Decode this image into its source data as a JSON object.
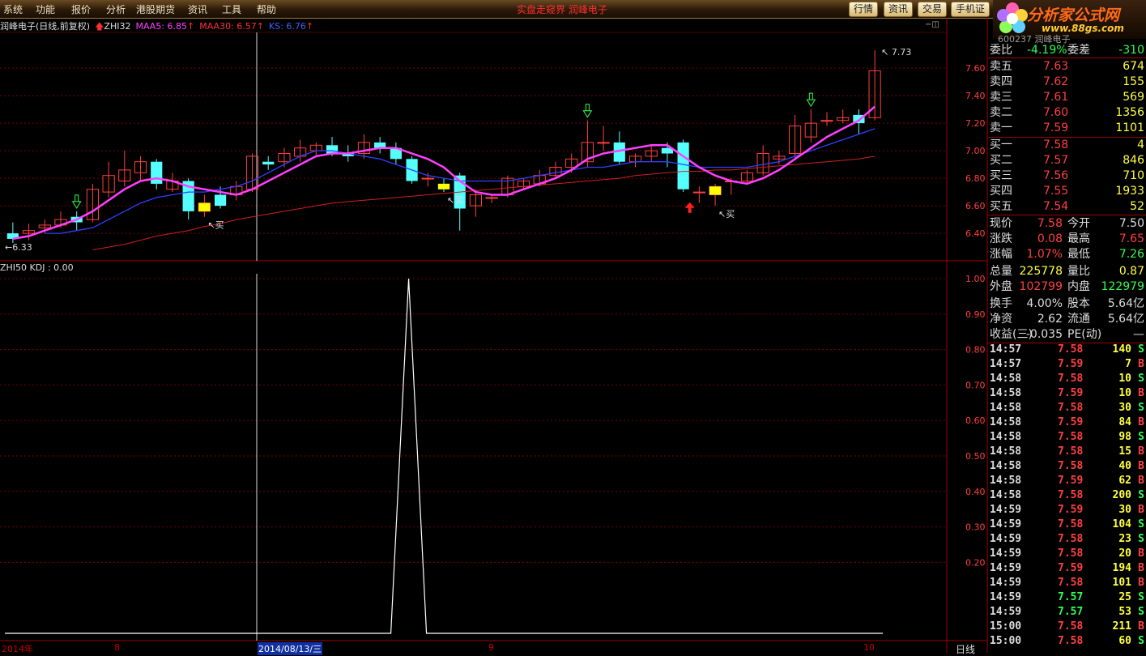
{
  "menu": [
    "系统",
    "功能",
    "报价",
    "分析",
    "港股期货",
    "资讯",
    "工具",
    "帮助"
  ],
  "center_title": "实盘走窥界  润峰电子",
  "toolbar": [
    "行情",
    "资讯",
    "交易",
    "手机证"
  ],
  "logo": {
    "text": "分析家公式网",
    "url": "www.88gs.com"
  },
  "stock_header": "600237 润峰电子",
  "info": {
    "name": "润峰电子(日线,前复权)",
    "zhi": "ZHI32",
    "maa5": "MAA5: 6.85",
    "maa30": "MAA30: 6.57",
    "ks": "KS: 6.76"
  },
  "kdj_label": "ZHI50 KDJ : 0.00",
  "annotations": {
    "high": "7.73",
    "low": "6.33",
    "buy": "买"
  },
  "price_axis": [
    "7.60",
    "7.40",
    "7.20",
    "7.00",
    "6.80",
    "6.60",
    "6.40"
  ],
  "kdj_axis": [
    "1.00",
    "0.90",
    "0.80",
    "0.70",
    "0.60",
    "0.50",
    "0.40",
    "0.30",
    "0.20"
  ],
  "x_axis": {
    "year": "2014年",
    "m8": "8",
    "cursor_date": "2014/08/13/三",
    "m9": "9",
    "m10": "10"
  },
  "day_label": "日线",
  "weibi": {
    "l1": "委比",
    "v1": "-4.19%",
    "l2": "委差",
    "v2": "-310"
  },
  "sell": [
    {
      "label": "卖五",
      "price": "7.63",
      "vol": "674"
    },
    {
      "label": "卖四",
      "price": "7.62",
      "vol": "155"
    },
    {
      "label": "卖三",
      "price": "7.61",
      "vol": "569"
    },
    {
      "label": "卖二",
      "price": "7.60",
      "vol": "1356"
    },
    {
      "label": "卖一",
      "price": "7.59",
      "vol": "1101"
    }
  ],
  "buy": [
    {
      "label": "买一",
      "price": "7.58",
      "vol": "4"
    },
    {
      "label": "买二",
      "price": "7.57",
      "vol": "846"
    },
    {
      "label": "买三",
      "price": "7.56",
      "vol": "710"
    },
    {
      "label": "买四",
      "price": "7.55",
      "vol": "1933"
    },
    {
      "label": "买五",
      "price": "7.54",
      "vol": "52"
    }
  ],
  "stats": [
    {
      "l1": "现价",
      "v1": "7.58",
      "c1": "red",
      "l2": "今开",
      "v2": "7.50",
      "c2": "wht"
    },
    {
      "l1": "涨跌",
      "v1": "0.08",
      "c1": "red",
      "l2": "最高",
      "v2": "7.65",
      "c2": "red"
    },
    {
      "l1": "涨幅",
      "v1": "1.07%",
      "c1": "red",
      "l2": "最低",
      "v2": "7.26",
      "c2": "green"
    },
    {
      "l1": "总量",
      "v1": "225778",
      "c1": "yel",
      "l2": "量比",
      "v2": "0.87",
      "c2": "yel"
    },
    {
      "l1": "外盘",
      "v1": "102799",
      "c1": "red",
      "l2": "内盘",
      "v2": "122979",
      "c2": "green"
    },
    {
      "l1": "换手",
      "v1": "4.00%",
      "c1": "wht",
      "l2": "股本",
      "v2": "5.64亿",
      "c2": "wht"
    },
    {
      "l1": "净资",
      "v1": "2.62",
      "c1": "wht",
      "l2": "流通",
      "v2": "5.64亿",
      "c2": "wht"
    },
    {
      "l1": "收益(三)",
      "v1": "-0.035",
      "c1": "wht",
      "l2": "PE(动)",
      "v2": "—",
      "c2": "wht"
    }
  ],
  "ticks": [
    {
      "t": "14:57",
      "p": "7.58",
      "v": "140",
      "s": "S"
    },
    {
      "t": "14:57",
      "p": "7.59",
      "v": "7",
      "s": "B"
    },
    {
      "t": "14:58",
      "p": "7.58",
      "v": "10",
      "s": "S"
    },
    {
      "t": "14:58",
      "p": "7.59",
      "v": "10",
      "s": "B"
    },
    {
      "t": "14:58",
      "p": "7.58",
      "v": "30",
      "s": "S"
    },
    {
      "t": "14:58",
      "p": "7.59",
      "v": "84",
      "s": "B"
    },
    {
      "t": "14:58",
      "p": "7.58",
      "v": "98",
      "s": "S"
    },
    {
      "t": "14:58",
      "p": "7.58",
      "v": "15",
      "s": "B"
    },
    {
      "t": "14:58",
      "p": "7.58",
      "v": "40",
      "s": "B"
    },
    {
      "t": "14:58",
      "p": "7.59",
      "v": "62",
      "s": "B"
    },
    {
      "t": "14:58",
      "p": "7.58",
      "v": "200",
      "s": "S"
    },
    {
      "t": "14:59",
      "p": "7.59",
      "v": "30",
      "s": "B"
    },
    {
      "t": "14:59",
      "p": "7.58",
      "v": "104",
      "s": "S"
    },
    {
      "t": "14:59",
      "p": "7.58",
      "v": "23",
      "s": "S"
    },
    {
      "t": "14:59",
      "p": "7.58",
      "v": "20",
      "s": "B"
    },
    {
      "t": "14:59",
      "p": "7.59",
      "v": "194",
      "s": "B"
    },
    {
      "t": "14:59",
      "p": "7.58",
      "v": "101",
      "s": "B"
    },
    {
      "t": "14:59",
      "p": "7.57",
      "v": "25",
      "s": "S"
    },
    {
      "t": "14:59",
      "p": "7.57",
      "v": "53",
      "s": "S"
    },
    {
      "t": "15:00",
      "p": "7.58",
      "v": "211",
      "s": "B"
    },
    {
      "t": "15:00",
      "p": "7.58",
      "v": "60",
      "s": "S"
    }
  ],
  "colors": {
    "up": "#ff4040",
    "down": "#55ffff",
    "ma5": "#ff40ff",
    "ma30": "#d02020",
    "ks": "#3040ff",
    "grid": "#7a0000"
  },
  "chart_data": {
    "type": "candlestick",
    "ylim": [
      6.33,
      7.73
    ],
    "candles": [
      [
        6.4,
        6.36,
        6.48,
        6.33
      ],
      [
        6.4,
        6.42,
        6.47,
        6.35
      ],
      [
        6.44,
        6.46,
        6.5,
        6.4
      ],
      [
        6.46,
        6.5,
        6.56,
        6.44
      ],
      [
        6.52,
        6.48,
        6.56,
        6.42
      ],
      [
        6.5,
        6.72,
        6.76,
        6.48
      ],
      [
        6.7,
        6.82,
        6.92,
        6.66
      ],
      [
        6.78,
        6.86,
        7.0,
        6.74
      ],
      [
        6.84,
        6.92,
        6.96,
        6.78
      ],
      [
        6.92,
        6.76,
        6.94,
        6.72
      ],
      [
        6.72,
        6.78,
        6.84,
        6.7
      ],
      [
        6.78,
        6.56,
        6.8,
        6.5
      ],
      [
        6.56,
        6.62,
        6.68,
        6.52
      ],
      [
        6.68,
        6.6,
        6.74,
        6.58
      ],
      [
        6.68,
        6.74,
        6.78,
        6.64
      ],
      [
        6.72,
        6.96,
        6.98,
        6.7
      ],
      [
        6.92,
        6.9,
        6.96,
        6.86
      ],
      [
        6.92,
        6.98,
        7.02,
        6.88
      ],
      [
        6.96,
        7.02,
        7.08,
        6.92
      ],
      [
        7.0,
        7.04,
        7.06,
        6.96
      ],
      [
        7.04,
        6.98,
        7.1,
        6.96
      ],
      [
        6.98,
        6.96,
        7.04,
        6.92
      ],
      [
        6.98,
        7.06,
        7.12,
        6.94
      ],
      [
        7.06,
        7.02,
        7.1,
        6.98
      ],
      [
        7.02,
        6.94,
        7.06,
        6.9
      ],
      [
        6.94,
        6.78,
        6.96,
        6.76
      ],
      [
        6.8,
        6.8,
        6.84,
        6.74
      ],
      [
        6.76,
        6.72,
        6.8,
        6.7
      ],
      [
        6.82,
        6.58,
        6.84,
        6.42
      ],
      [
        6.6,
        6.68,
        6.72,
        6.52
      ],
      [
        6.66,
        6.66,
        6.68,
        6.62
      ],
      [
        6.68,
        6.8,
        6.82,
        6.66
      ],
      [
        6.74,
        6.78,
        6.8,
        6.72
      ],
      [
        6.76,
        6.82,
        6.86,
        6.74
      ],
      [
        6.82,
        6.88,
        6.92,
        6.8
      ],
      [
        6.88,
        6.94,
        6.98,
        6.84
      ],
      [
        6.92,
        7.06,
        7.22,
        6.88
      ],
      [
        7.06,
        7.06,
        7.18,
        7.0
      ],
      [
        7.06,
        6.92,
        7.14,
        6.9
      ],
      [
        6.92,
        6.96,
        6.98,
        6.88
      ],
      [
        6.96,
        7.0,
        7.04,
        6.92
      ],
      [
        7.02,
        6.98,
        7.06,
        6.88
      ],
      [
        7.06,
        6.72,
        7.08,
        6.7
      ],
      [
        6.7,
        6.7,
        6.74,
        6.62
      ],
      [
        6.68,
        6.74,
        6.76,
        6.6
      ],
      [
        6.78,
        6.78,
        6.8,
        6.68
      ],
      [
        6.78,
        6.84,
        6.86,
        6.76
      ],
      [
        6.84,
        6.98,
        7.04,
        6.82
      ],
      [
        6.94,
        6.96,
        7.0,
        6.9
      ],
      [
        6.98,
        7.18,
        7.26,
        6.94
      ],
      [
        7.1,
        7.2,
        7.3,
        7.06
      ],
      [
        7.22,
        7.22,
        7.28,
        7.18
      ],
      [
        7.22,
        7.24,
        7.3,
        7.2
      ],
      [
        7.26,
        7.2,
        7.3,
        7.12
      ],
      [
        7.24,
        7.58,
        7.73,
        7.22
      ]
    ],
    "ma5": [
      6.36,
      6.38,
      6.42,
      6.46,
      6.5,
      6.56,
      6.64,
      6.72,
      6.78,
      6.8,
      6.78,
      6.74,
      6.72,
      6.7,
      6.68,
      6.72,
      6.78,
      6.84,
      6.9,
      6.96,
      6.98,
      6.98,
      7.0,
      7.02,
      7.02,
      6.98,
      6.94,
      6.88,
      6.78,
      6.7,
      6.68,
      6.68,
      6.72,
      6.76,
      6.8,
      6.86,
      6.94,
      6.98,
      7.0,
      7.02,
      7.04,
      7.04,
      6.96,
      6.88,
      6.82,
      6.78,
      6.76,
      6.8,
      6.86,
      6.94,
      7.02,
      7.1,
      7.16,
      7.22,
      7.32
    ],
    "ma30": [
      null,
      null,
      null,
      null,
      null,
      6.28,
      6.3,
      6.32,
      6.35,
      6.38,
      6.4,
      6.42,
      6.45,
      6.47,
      6.5,
      6.52,
      6.54,
      6.56,
      6.58,
      6.6,
      6.62,
      6.63,
      6.64,
      6.65,
      6.66,
      6.67,
      6.68,
      6.69,
      6.7,
      6.71,
      6.72,
      6.73,
      6.74,
      6.75,
      6.76,
      6.77,
      6.78,
      6.79,
      6.8,
      6.82,
      6.83,
      6.84,
      6.85,
      6.85,
      6.86,
      6.86,
      6.87,
      6.88,
      6.89,
      6.9,
      6.91,
      6.92,
      6.93,
      6.94,
      6.96
    ],
    "ks": [
      null,
      null,
      6.4,
      6.4,
      6.42,
      6.44,
      6.5,
      6.56,
      6.62,
      6.66,
      6.68,
      6.7,
      6.7,
      6.72,
      6.74,
      6.78,
      6.84,
      6.9,
      6.96,
      7.0,
      7.0,
      6.98,
      6.96,
      6.94,
      6.9,
      6.86,
      6.82,
      6.8,
      6.78,
      6.78,
      6.78,
      6.78,
      6.8,
      6.82,
      6.84,
      6.86,
      6.88,
      6.88,
      6.9,
      6.92,
      6.92,
      6.92,
      6.9,
      6.88,
      6.88,
      6.88,
      6.88,
      6.9,
      6.92,
      6.96,
      7.0,
      7.04,
      7.08,
      7.12,
      7.16
    ],
    "buy_signals": [
      12,
      27,
      44
    ],
    "up_arrows": [
      4,
      36,
      50
    ],
    "kdj": {
      "ylim": [
        0,
        1
      ],
      "peak_index": 25,
      "peak_value": 1.0
    }
  }
}
